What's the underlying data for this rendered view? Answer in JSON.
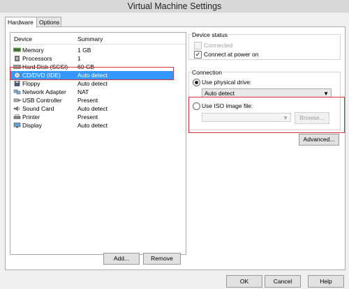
{
  "window": {
    "title": "Virtual Machine Settings"
  },
  "tabs": [
    {
      "label": "Hardware"
    },
    {
      "label": "Options"
    }
  ],
  "device_list": {
    "headers": {
      "device": "Device",
      "summary": "Summary"
    },
    "rows": [
      {
        "device": "Memory",
        "summary": "1 GB",
        "icon": "memory-icon"
      },
      {
        "device": "Processors",
        "summary": "1",
        "icon": "processor-icon"
      },
      {
        "device": "Hard Disk (SCSI)",
        "summary": "60 GB",
        "icon": "hard-disk-icon"
      },
      {
        "device": "CD/DVD (IDE)",
        "summary": "Auto detect",
        "icon": "cd-dvd-icon",
        "selected": true
      },
      {
        "device": "Floppy",
        "summary": "Auto detect",
        "icon": "floppy-icon"
      },
      {
        "device": "Network Adapter",
        "summary": "NAT",
        "icon": "network-adapter-icon"
      },
      {
        "device": "USB Controller",
        "summary": "Present",
        "icon": "usb-icon"
      },
      {
        "device": "Sound Card",
        "summary": "Auto detect",
        "icon": "sound-card-icon"
      },
      {
        "device": "Printer",
        "summary": "Present",
        "icon": "printer-icon"
      },
      {
        "device": "Display",
        "summary": "Auto detect",
        "icon": "display-icon"
      }
    ],
    "add_label": "Add...",
    "remove_label": "Remove"
  },
  "device_status": {
    "title": "Device status",
    "connected_label": "Connected",
    "connected_checked": false,
    "connect_power_label": "Connect at power on",
    "connect_power_checked": true
  },
  "connection": {
    "title": "Connection",
    "physical_label": "Use physical drive:",
    "physical_value": "Auto detect",
    "iso_label": "Use ISO image file:",
    "iso_value": "",
    "browse_label": "Browse...",
    "selected": "physical"
  },
  "advanced_label": "Advanced...",
  "footer": {
    "ok": "OK",
    "cancel": "Cancel",
    "help": "Help"
  },
  "colors": {
    "selection": "#3399ff",
    "highlight_box": "#d8333b"
  }
}
